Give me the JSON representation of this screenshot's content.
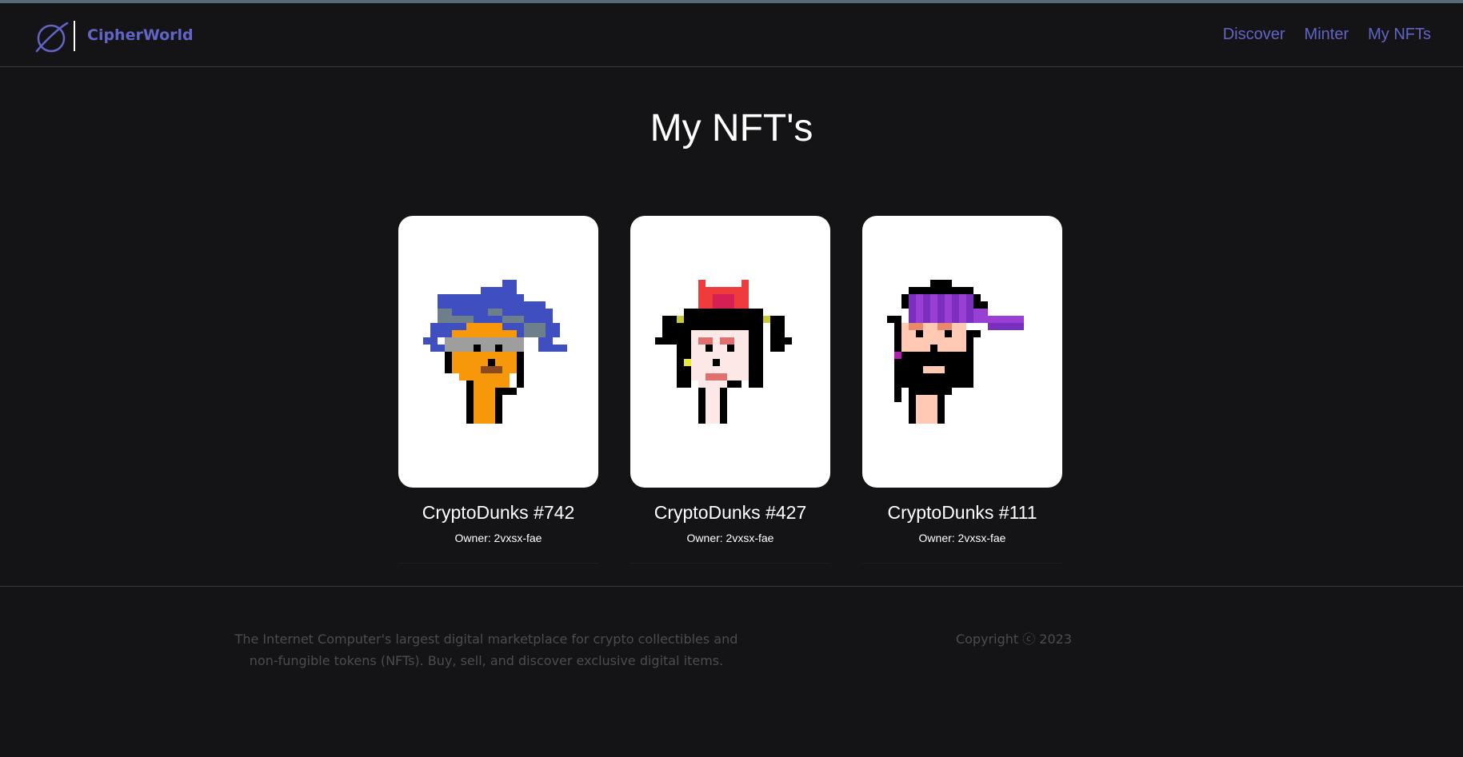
{
  "header": {
    "brand": "CipherWorld",
    "logo_icon": "planet-icon",
    "nav": [
      {
        "label": "Discover"
      },
      {
        "label": "Minter"
      },
      {
        "label": "My NFTs"
      }
    ]
  },
  "main": {
    "title": "My NFT's",
    "cards": [
      {
        "name": "CryptoDunks #742",
        "owner": "Owner: 2vxsx-fae",
        "image": "pixel-punk-blue-hair-icon"
      },
      {
        "name": "CryptoDunks #427",
        "owner": "Owner: 2vxsx-fae",
        "image": "pixel-punk-red-bow-icon"
      },
      {
        "name": "CryptoDunks #111",
        "owner": "Owner: 2vxsx-fae",
        "image": "pixel-punk-purple-cap-icon"
      }
    ]
  },
  "footer": {
    "description": "The Internet Computer's largest digital marketplace for crypto collectibles and non-fungible tokens (NFTs). Buy, sell, and discover exclusive digital items.",
    "copyright": "Copyright ⓒ 2023"
  },
  "colors": {
    "background": "#141416",
    "accent": "#6264c7",
    "card_bg": "#ffffff",
    "muted_text": "#4b4b52"
  }
}
